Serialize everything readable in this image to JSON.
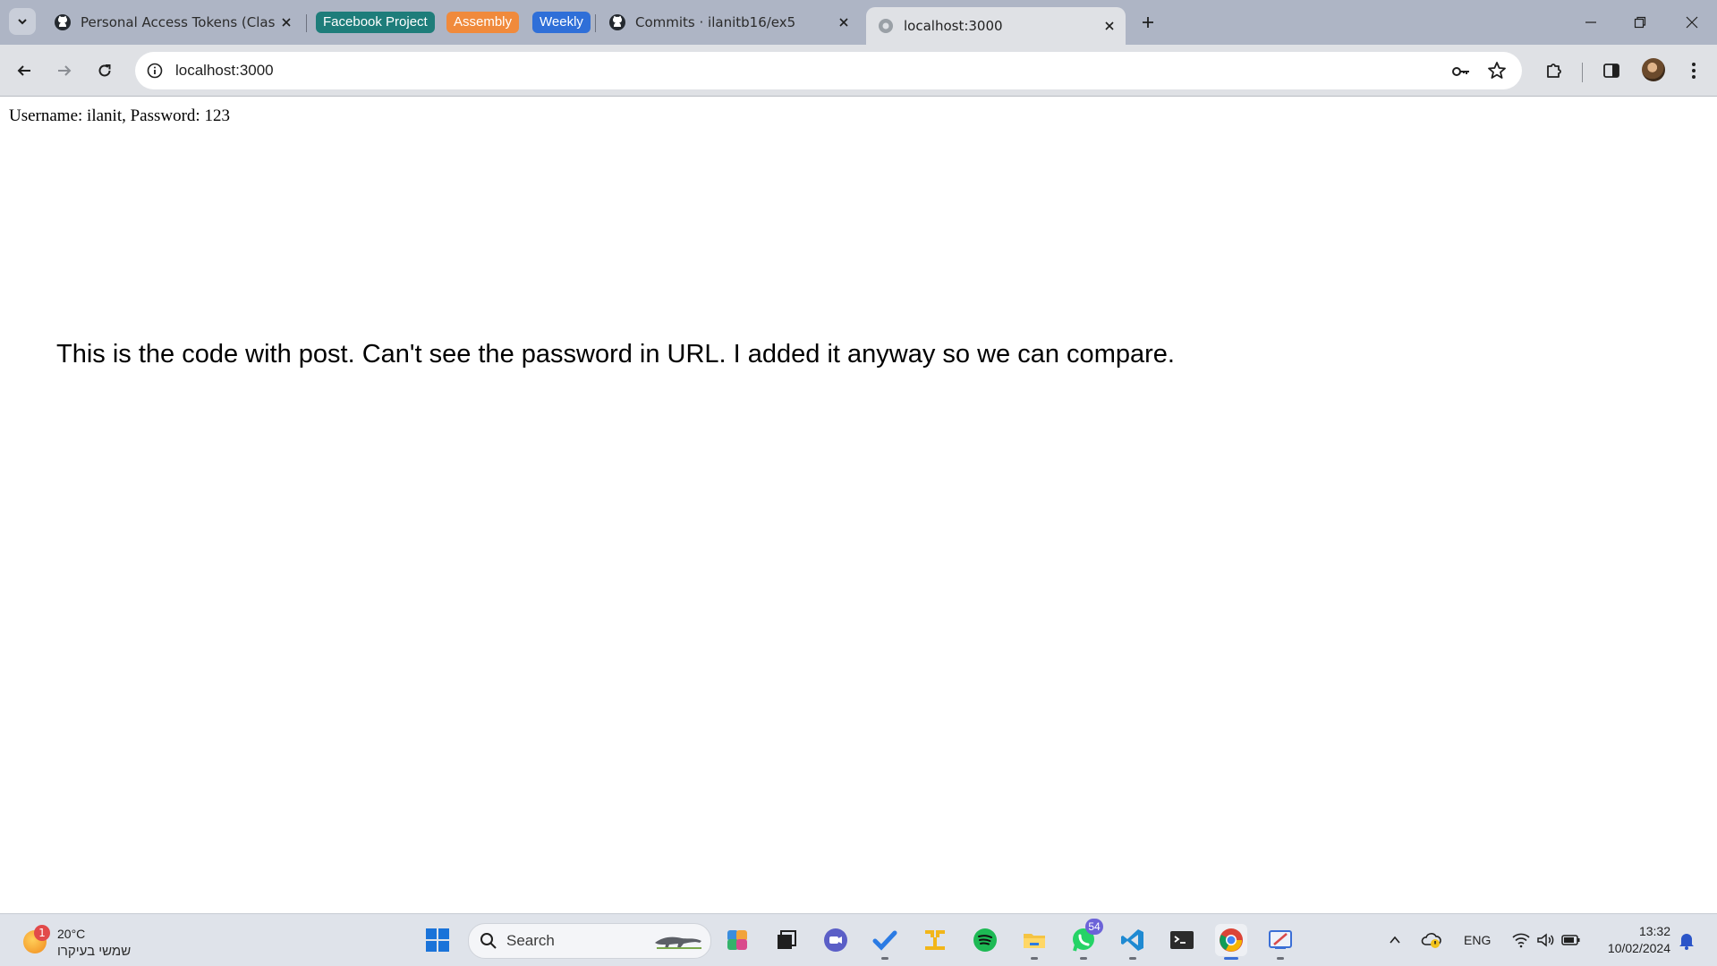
{
  "browser": {
    "tabs": [
      {
        "title": "Personal Access Tokens (Classic",
        "icon": "github-icon"
      },
      {
        "title": "Commits · ilanitb16/ex5",
        "icon": "github-icon"
      },
      {
        "title": "localhost:3000",
        "icon": "globe-icon",
        "active": true
      }
    ],
    "tab_groups": [
      {
        "label": "Facebook Project",
        "color": "#1e7d7a"
      },
      {
        "label": "Assembly",
        "color": "#f08a3c"
      },
      {
        "label": "Weekly",
        "color": "#2f6fd8"
      }
    ],
    "address": "localhost:3000"
  },
  "page": {
    "credentials": "Username: ilanit, Password: 123",
    "message": "This is the code with post. Can't see the password in URL. I added it anyway so we can compare."
  },
  "taskbar": {
    "weather": {
      "temp": "20°C",
      "condition": "שמשי בעיקרו",
      "badge": "1"
    },
    "search_label": "Search",
    "whatsapp_badge": "54",
    "language": "ENG",
    "time": "13:32",
    "date": "10/02/2024"
  },
  "colors": {
    "tabstrip": "#aeb5c5",
    "toolbar": "#dfe1e5",
    "taskbar": "#dfe3ea"
  }
}
